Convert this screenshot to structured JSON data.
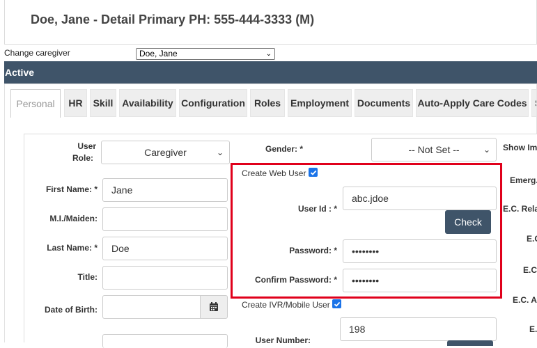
{
  "header": {
    "title": "Doe, Jane - Detail Primary PH: 555-444-3333 (M)"
  },
  "caregiver": {
    "label": "Change caregiver",
    "selected": "Doe, Jane"
  },
  "status": {
    "label": "Active"
  },
  "tabs": [
    {
      "label": "Personal"
    },
    {
      "label": "HR"
    },
    {
      "label": "Skill"
    },
    {
      "label": "Availability"
    },
    {
      "label": "Configuration"
    },
    {
      "label": "Roles"
    },
    {
      "label": "Employment"
    },
    {
      "label": "Documents"
    },
    {
      "label": "Auto-Apply Care Codes"
    },
    {
      "label": "S"
    }
  ],
  "form": {
    "user_role": {
      "label_line1": "User",
      "label_line2": "Role:",
      "value": "Caregiver"
    },
    "first_name": {
      "label": "First Name: *",
      "value": "Jane"
    },
    "mi_maiden": {
      "label": "M.I./Maiden:",
      "value": ""
    },
    "last_name": {
      "label": "Last Name: *",
      "value": "Doe"
    },
    "title": {
      "label": "Title:",
      "value": ""
    },
    "dob": {
      "label": "Date of Birth:",
      "value": ""
    },
    "gender": {
      "label": "Gender: *",
      "value": "-- Not Set --"
    },
    "web_user": {
      "label": "Create Web User"
    },
    "user_id": {
      "label": "User Id : *",
      "value": "abc.jdoe"
    },
    "check_button": "Check",
    "password": {
      "label": "Password: *",
      "value": "••••••••"
    },
    "confirm_password": {
      "label": "Confirm Password: *",
      "value": "••••••••"
    },
    "ivr_user": {
      "label": "Create IVR/Mobile User"
    },
    "user_number": {
      "label": "User Number:",
      "value": "198"
    }
  },
  "right_column": {
    "show_im": "Show Im",
    "emerg": "Emerg.",
    "ec_rela": "E.C. Rela",
    "ec_c": "E.C",
    "ec_c2": "E.C",
    "ec_a": "E.C. A",
    "ec_e": "E."
  },
  "colors": {
    "header_bar": "#3f5469",
    "highlight_border": "#e0001b",
    "checkbox": "#1a73e8"
  }
}
